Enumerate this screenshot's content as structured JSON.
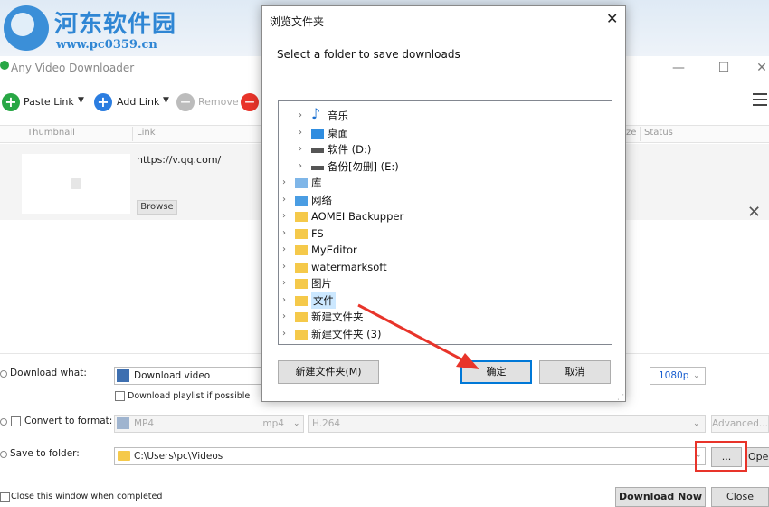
{
  "watermark": {
    "title": "河东软件园",
    "url": "www.pc0359.cn"
  },
  "app": {
    "title": "Any Video Downloader",
    "minimize": "—",
    "maximize": "☐",
    "close": "✕"
  },
  "toolbar": {
    "paste_link": "Paste Link",
    "add_link": "Add Link",
    "remove": "Remove",
    "plus_symbol": "+",
    "minus_symbol": "—"
  },
  "table": {
    "headers": [
      "Thumbnail",
      "Link",
      "ze",
      "Status"
    ],
    "row": {
      "link": "https://v.qq.com/",
      "browse_label": "Browse",
      "close_symbol": "✕"
    }
  },
  "options": {
    "download_what_label": "Download what:",
    "download_what_value": "Download video",
    "resolution": "1080p",
    "download_playlist_label": "Download playlist if possible",
    "convert_label": "Convert to format:",
    "format_value": "MP4",
    "format_ext": ".mp4",
    "codec_value": "H.264",
    "advanced_label": "Advanced...",
    "save_label": "Save to folder:",
    "save_path": "C:\\Users\\pc\\Videos",
    "ellipsis_label": "...",
    "open_label": "Open",
    "close_when_done_label": "Close this window when completed",
    "download_now_label": "Download Now",
    "close_label": "Close"
  },
  "dialog": {
    "title": "浏览文件夹",
    "close_symbol": "✕",
    "message": "Select a folder to save downloads",
    "tree": [
      {
        "label": "音乐",
        "icon": "music-note-icon",
        "indent": 1
      },
      {
        "label": "桌面",
        "icon": "desktop-icon",
        "indent": 1
      },
      {
        "label": "软件 (D:)",
        "icon": "drive-icon",
        "indent": 1
      },
      {
        "label": "备份[勿删] (E:)",
        "icon": "drive-icon",
        "indent": 1
      },
      {
        "label": "库",
        "icon": "library-icon",
        "indent": 0
      },
      {
        "label": "网络",
        "icon": "network-icon",
        "indent": 0
      },
      {
        "label": "AOMEI Backupper",
        "icon": "folder-icon",
        "indent": 0
      },
      {
        "label": "FS",
        "icon": "folder-icon",
        "indent": 0
      },
      {
        "label": "MyEditor",
        "icon": "folder-icon",
        "indent": 0
      },
      {
        "label": "watermarksoft",
        "icon": "folder-icon",
        "indent": 0
      },
      {
        "label": "图片",
        "icon": "folder-icon",
        "indent": 0
      },
      {
        "label": "文件",
        "icon": "folder-icon",
        "indent": 0,
        "selected": true
      },
      {
        "label": "新建文件夹",
        "icon": "folder-icon",
        "indent": 0
      },
      {
        "label": "新建文件夹 (3)",
        "icon": "folder-icon",
        "indent": 0
      }
    ],
    "new_folder_button": "新建文件夹(M)",
    "ok_button": "确定",
    "cancel_button": "取消"
  },
  "colors": {
    "accent_blue": "#0078d7",
    "green": "#28a745",
    "red": "#e8342a",
    "folder": "#f5c94a"
  }
}
